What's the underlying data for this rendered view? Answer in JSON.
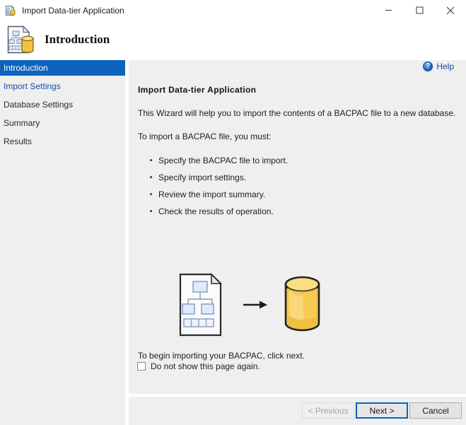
{
  "window": {
    "title": "Import Data-tier Application",
    "icon": "data-tier-application-icon",
    "controls": {
      "minimize": "minimize-icon",
      "maximize": "maximize-icon",
      "close": "close-icon"
    }
  },
  "header": {
    "title": "Introduction",
    "icon": "data-tier-application-icon"
  },
  "sidebar": {
    "items": [
      {
        "label": "Introduction",
        "state": "selected"
      },
      {
        "label": "Import Settings",
        "state": "available"
      },
      {
        "label": "Database Settings",
        "state": "pending"
      },
      {
        "label": "Summary",
        "state": "pending"
      },
      {
        "label": "Results",
        "state": "pending"
      }
    ]
  },
  "content": {
    "help_label": "Help",
    "help_icon": "help-circle-icon",
    "section_title": "Import Data-tier Application",
    "intro_paragraph": "This Wizard will help you to import the contents of a BACPAC file to a new database.",
    "instructions_lead": "To import a BACPAC file, you must:",
    "bullets": [
      "Specify the BACPAC file to import.",
      "Specify import settings.",
      "Review the import summary.",
      "Check the results of operation."
    ],
    "illustration": {
      "source_icon": "bacpac-document-icon",
      "arrow_icon": "arrow-right-icon",
      "target_icon": "database-cylinder-icon"
    },
    "begin_text": "To begin importing your BACPAC, click next.",
    "checkbox": {
      "label": "Do not show this page again.",
      "checked": false
    }
  },
  "footer": {
    "previous_label": "< Previous",
    "next_label": "Next >",
    "cancel_label": "Cancel"
  },
  "colors": {
    "accent_blue": "#0c62be",
    "link_blue": "#14489c",
    "panel_gray": "#efefef",
    "titlebar_white": "#ffffff",
    "db_gold": "#f5c444",
    "text_dark": "#1d1d1d",
    "disabled_gray": "#a6a6a6"
  }
}
